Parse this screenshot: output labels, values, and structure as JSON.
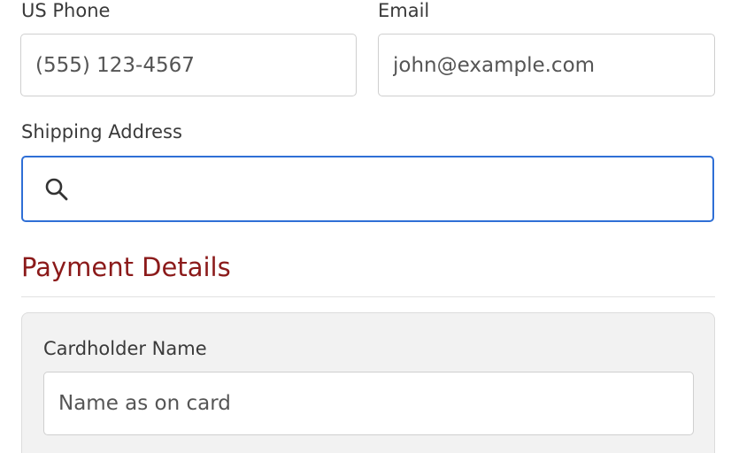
{
  "contact": {
    "phone_label": "US Phone",
    "phone_placeholder": "(555) 123-4567",
    "email_label": "Email",
    "email_placeholder": "john@example.com"
  },
  "shipping": {
    "address_label": "Shipping Address",
    "address_value": "",
    "search_icon": "search-icon",
    "focus_color": "#2f6fd6"
  },
  "payment": {
    "section_title": "Payment Details",
    "title_color": "#8b1a1a",
    "cardholder_label": "Cardholder Name",
    "cardholder_placeholder": "Name as on card"
  }
}
